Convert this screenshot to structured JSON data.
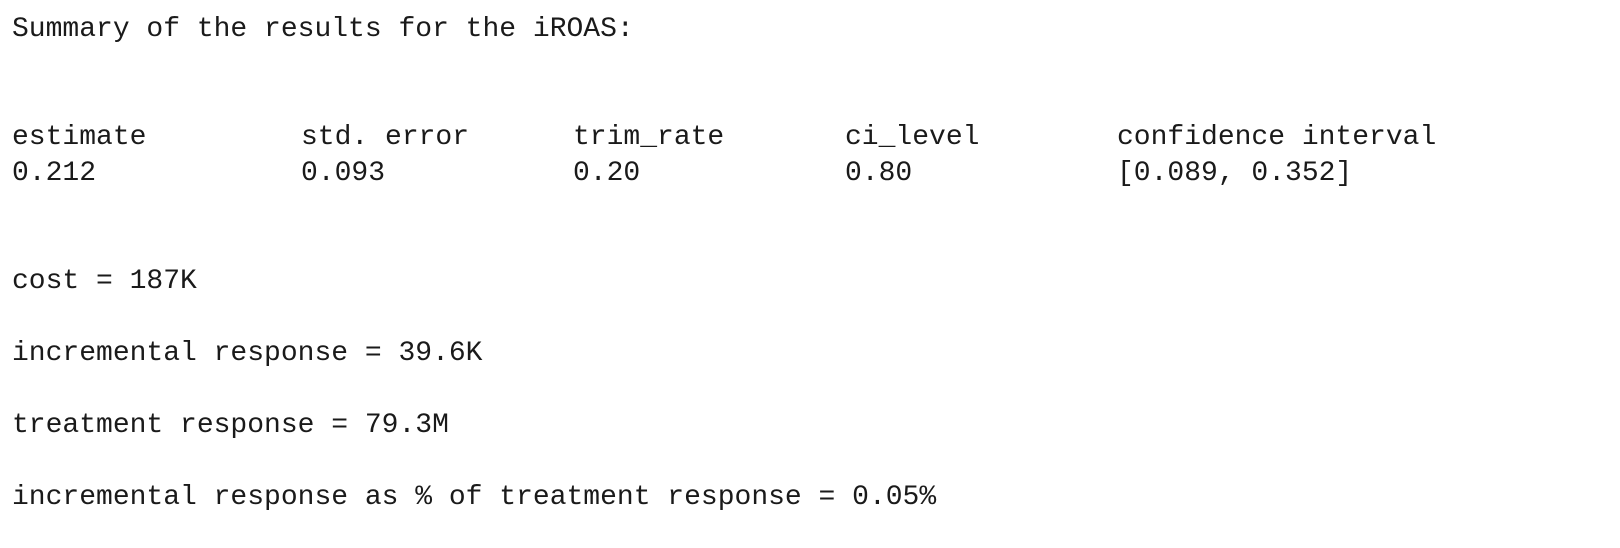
{
  "title": "Summary of the results for the iROAS:",
  "table": {
    "headers": [
      "estimate",
      "std. error",
      "trim_rate",
      "ci_level",
      "confidence interval"
    ],
    "values": [
      "0.212",
      "0.093",
      "0.20",
      "0.80",
      "[0.089, 0.352]"
    ]
  },
  "metrics": [
    "cost = 187K",
    "incremental response = 39.6K",
    "treatment response = 79.3M",
    "incremental response as % of treatment response = 0.05%"
  ]
}
